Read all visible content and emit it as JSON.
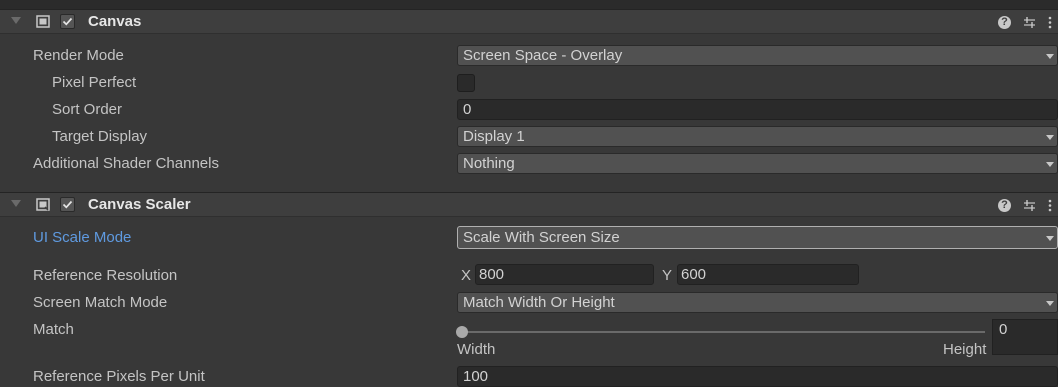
{
  "canvas": {
    "title": "Canvas",
    "enabled": true,
    "render_mode": {
      "label": "Render Mode",
      "value": "Screen Space - Overlay"
    },
    "pixel_perfect": {
      "label": "Pixel Perfect",
      "checked": false
    },
    "sort_order": {
      "label": "Sort Order",
      "value": "0"
    },
    "target_display": {
      "label": "Target Display",
      "value": "Display 1"
    },
    "additional_shader_channels": {
      "label": "Additional Shader Channels",
      "value": "Nothing"
    }
  },
  "canvas_scaler": {
    "title": "Canvas Scaler",
    "enabled": true,
    "ui_scale_mode": {
      "label": "UI Scale Mode",
      "value": "Scale With Screen Size"
    },
    "reference_resolution": {
      "label": "Reference Resolution",
      "x_label": "X",
      "x": "800",
      "y_label": "Y",
      "y": "600"
    },
    "screen_match_mode": {
      "label": "Screen Match Mode",
      "value": "Match Width Or Height"
    },
    "match": {
      "label": "Match",
      "value": "0",
      "left_label": "Width",
      "right_label": "Height"
    },
    "reference_pixels_per_unit": {
      "label": "Reference Pixels Per Unit",
      "value": "100"
    }
  },
  "icons": [
    "foldout-arrow-icon",
    "canvas-icon",
    "checkmark-icon",
    "help-icon",
    "preset-sliders-icon",
    "kebab-menu-icon",
    "canvas-scaler-icon"
  ],
  "colors": {
    "background": "#383838",
    "header": "#3e3e3e",
    "field": "#515151",
    "text_field": "#2a2a2a",
    "highlight_label": "#5f9ae0"
  }
}
